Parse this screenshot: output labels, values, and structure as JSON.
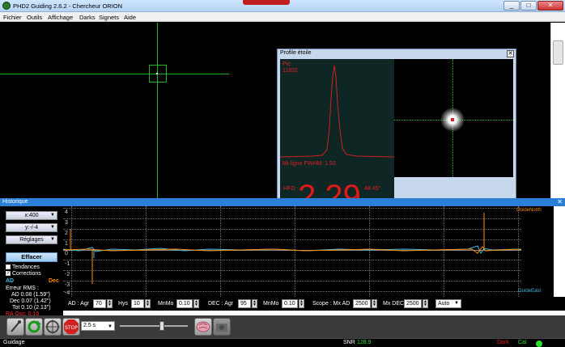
{
  "window": {
    "title": "PHD2 Guiding 2.6.2 - Chercheur ORION",
    "minimize": "_",
    "maximize": "□",
    "close": "✕"
  },
  "menu": [
    "Fichier",
    "Outils",
    "Affichage",
    "Darks",
    "Signets",
    "Aide"
  ],
  "profile": {
    "title": "Profile étoile",
    "close": "✕",
    "peak_label": "Pic:",
    "peak_value": "11832",
    "fwhm": "Mi-ligne FWHM: 1.92",
    "hfd_label": "HFD:",
    "hfd_value": "2.29",
    "hfd_arcsec": "48.45\""
  },
  "history": {
    "title": "Historique",
    "close": "✕",
    "x_scale": "x:400",
    "y_scale": "y:-/-4",
    "settings": "Réglages",
    "clear": "Effacer",
    "trends": "Tendances",
    "corrections": "Corrections",
    "corrections_checked": true,
    "legend_ra": "AD",
    "legend_dec": "Dec",
    "rms_title": "Erreur RMS :",
    "rms_ra": "AD 0.08 (1.59\")",
    "rms_dec": "Dec 0.07 (1.42\")",
    "rms_tot": "Tot 0.10 (2.13\")",
    "ra_osc": "RA Osc: 0.10",
    "guide_north": "GuideNorth",
    "guide_east": "GuideEast",
    "y_ticks": [
      "4",
      "3",
      "2",
      "1",
      "0",
      "-1",
      "-2",
      "-3",
      "-4"
    ],
    "colors": {
      "ra": "#3fb8e8",
      "dec": "#ff8c00",
      "ra_osc": "#ff3030",
      "panel_bar": "#2a7fd6"
    }
  },
  "params": {
    "ad_agr_label": "AD : Agr",
    "ad_agr": "70",
    "hys_label": "Hys",
    "hys": "10",
    "minmo_label": "MnMo",
    "minmo": "0.10",
    "dec_agr_label": "DEC : Agr",
    "dec_agr": "95",
    "dec_minmo_label": "MnMo",
    "dec_minmo": "0.10",
    "scope_label": "Scope : Mx AD",
    "mx_ad": "2500",
    "mx_dec_label": "Mx DEC",
    "mx_dec": "2500",
    "dec_mode": "Auto"
  },
  "toolbar": {
    "exposure": "2.5 s",
    "exposure_level": 0.62
  },
  "status": {
    "left": "Guidage",
    "snr_label": "SNR",
    "snr_value": "128.9",
    "dark": "Dark",
    "cal": "Cal"
  }
}
